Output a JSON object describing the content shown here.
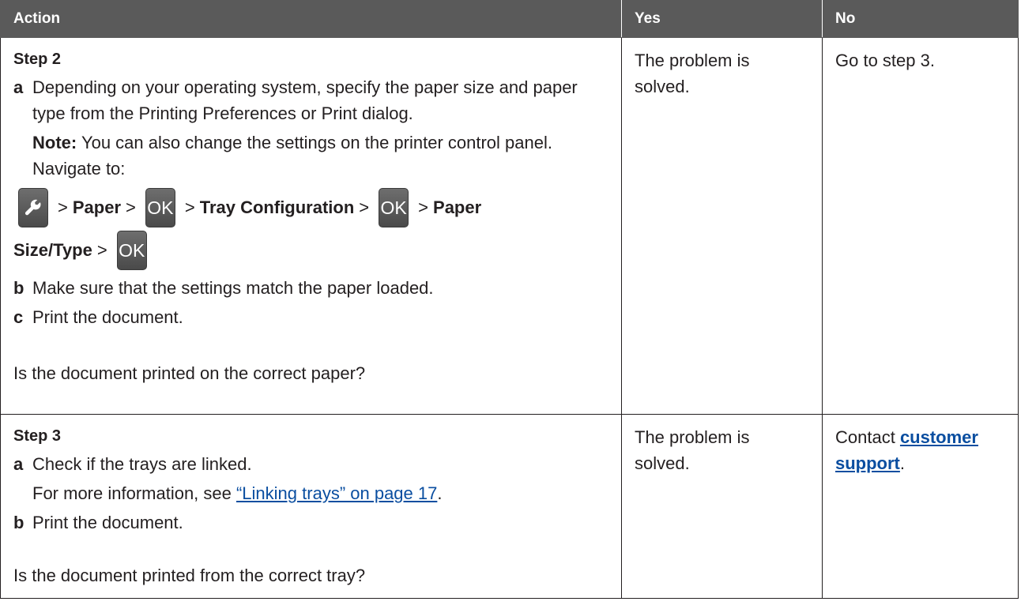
{
  "headers": {
    "action": "Action",
    "yes": "Yes",
    "no": "No"
  },
  "step2": {
    "title": "Step 2",
    "a_letter": "a",
    "a_text": "Depending on your operating system, specify the paper size and paper type from the Printing Preferences or Print dialog.",
    "note_label": "Note:",
    "note_text": "You can also change the settings on the printer control panel. Navigate to:",
    "nav": {
      "sep": ">",
      "paper": "Paper",
      "ok": "OK",
      "tray_config": "Tray Configuration",
      "paper_size_1": "Paper",
      "paper_size_2": "Size/Type"
    },
    "b_letter": "b",
    "b_text": "Make sure that the settings match the paper loaded.",
    "c_letter": "c",
    "c_text": "Print the document.",
    "question": "Is the document printed on the correct paper?",
    "yes": "The problem is solved.",
    "no": "Go to step 3."
  },
  "step3": {
    "title": "Step 3",
    "a_letter": "a",
    "a_text": "Check if the trays are linked.",
    "more_info_prefix": "For more information, see ",
    "more_info_link": "“Linking trays” on page 17",
    "more_info_suffix": ".",
    "b_letter": "b",
    "b_text": "Print the document.",
    "question": "Is the document printed from the correct tray?",
    "yes": "The problem is solved.",
    "no_prefix": "Contact ",
    "no_link": "customer support",
    "no_suffix": "."
  }
}
